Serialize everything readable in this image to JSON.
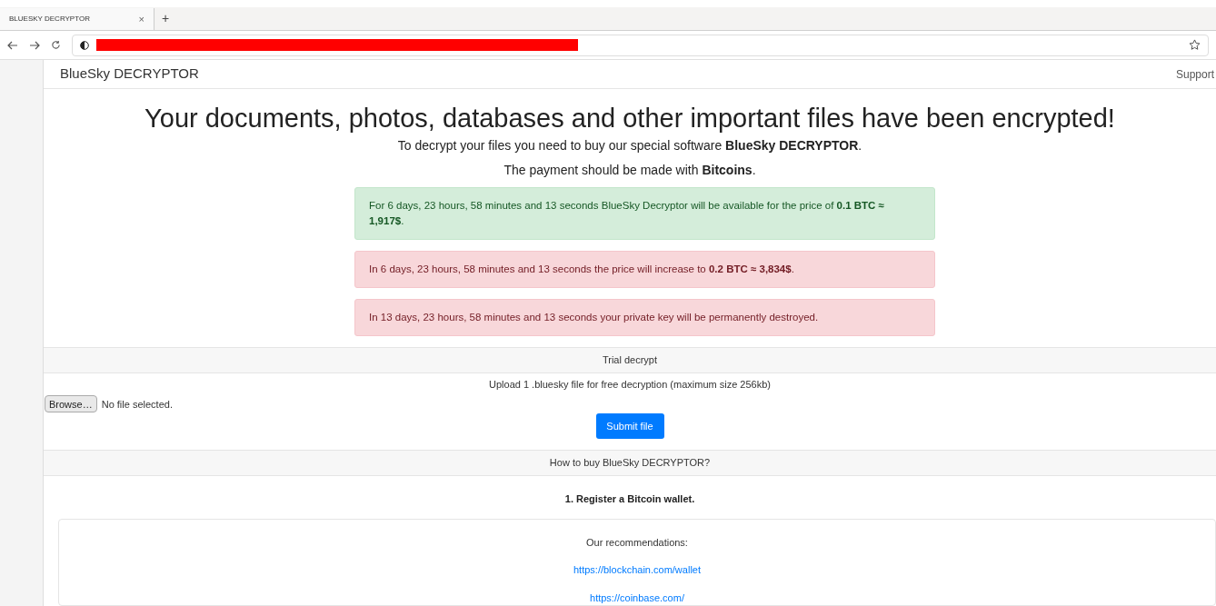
{
  "browser": {
    "tabs": [
      {
        "title": "BLUESKY DECRYPTOR",
        "selected": true,
        "close": "×"
      }
    ],
    "new_tab": "+"
  },
  "navbar": {
    "brand": "BlueSky DECRYPTOR",
    "link": "Support"
  },
  "headline": "Your documents, photos, databases and other important files have been encrypted!",
  "intro": [
    "To decrypt your files you need to buy our special software **BlueSky DECRYPTOR**.",
    "The payment should be made with **Bitcoins**."
  ],
  "alerts": [
    {
      "kind": "success",
      "text": "For 6 days, 23 hours, 58 minutes and 13 seconds BlueSky Decryptor will be available for the price of **0.1 BTC ≈ 1,917$**."
    },
    {
      "kind": "danger",
      "text": "In 6 days, 23 hours, 58 minutes and 13 seconds the price will increase to **0.2 BTC ≈ 3,834$**."
    },
    {
      "kind": "danger",
      "text": "In 13 days, 23 hours, 58 minutes and 13 seconds your private key will be permanently destroyed."
    }
  ],
  "trial": {
    "header": "Trial decrypt",
    "text": "Upload 1 .bluesky file for free decryption (maximum size 256kb)",
    "browse_button": "Browse…",
    "file_status": "No file selected.",
    "submit_button": "Submit file"
  },
  "how_to_buy": {
    "header": "How to buy BlueSky DECRYPTOR?",
    "step": "1. Register a Bitcoin wallet.",
    "recommendations_label": "Our recommendations:",
    "links": [
      "https://blockchain.com/wallet",
      "https://coinbase.com/"
    ]
  }
}
